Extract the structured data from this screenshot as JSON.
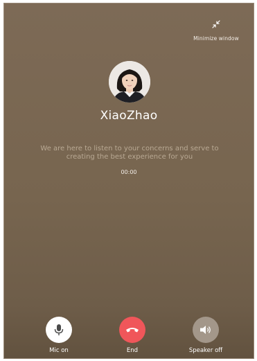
{
  "header": {
    "minimize_label": "Minimize window"
  },
  "contact": {
    "name": "XiaoZhao"
  },
  "call": {
    "message_line1": "We are here to listen to your concerns and serve to",
    "message_line2": "creating the best experience for you",
    "timer": "00:00"
  },
  "controls": {
    "mic_label": "Mic on",
    "end_label": "End",
    "speaker_label": "Speaker off"
  },
  "colors": {
    "background": "#77654f",
    "end_button": "#f0565a",
    "mic_button": "#ffffff",
    "speaker_button": "#a3978a"
  }
}
